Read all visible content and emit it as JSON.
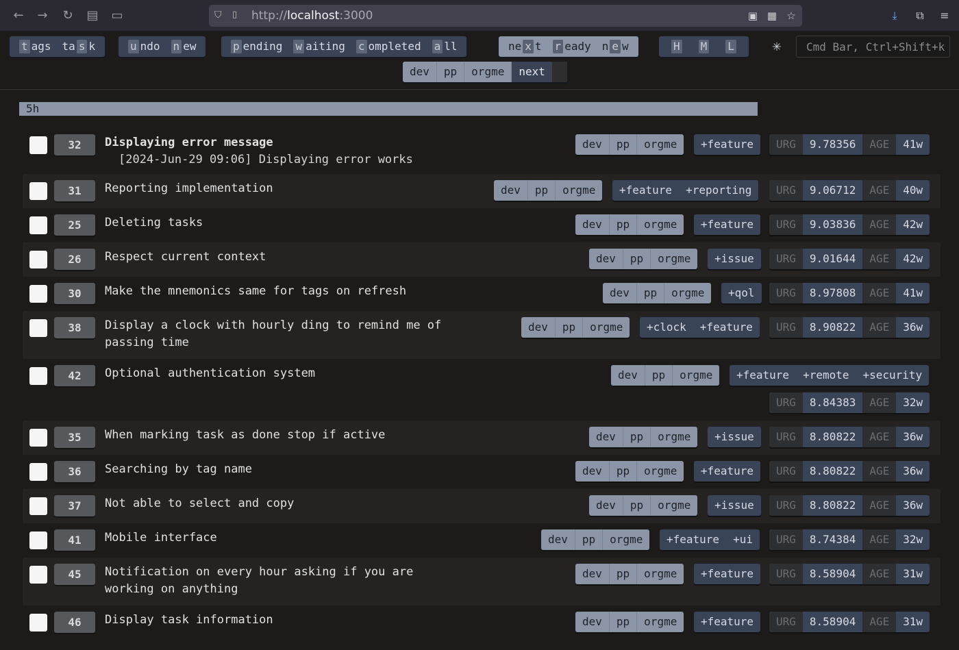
{
  "browser": {
    "url_proto": "http://",
    "url_host": "localhost",
    "url_port": ":3000"
  },
  "toolbar": {
    "groups": [
      {
        "buttons": [
          {
            "mnemonic": "t",
            "rest": "ags"
          },
          {
            "pre": "ta",
            "mnemonic": "s",
            "rest": "k"
          }
        ]
      },
      {
        "buttons": [
          {
            "mnemonic": "u",
            "rest": "ndo"
          },
          {
            "mnemonic": "n",
            "rest": "ew"
          }
        ]
      },
      {
        "buttons": [
          {
            "mnemonic": "p",
            "rest": "ending"
          },
          {
            "mnemonic": "w",
            "rest": "aiting"
          },
          {
            "mnemonic": "c",
            "rest": "ompleted"
          },
          {
            "mnemonic": "a",
            "rest": "ll"
          }
        ]
      },
      {
        "buttons": [
          {
            "pre": "ne",
            "mnemonic": "x",
            "rest": "t"
          },
          {
            "mnemonic": "r",
            "rest": "eady"
          },
          {
            "pre": "n",
            "mnemonic": "e",
            "rest": "w"
          }
        ]
      },
      {
        "buttons": [
          {
            "mnemonic": "H"
          },
          {
            "mnemonic": "M"
          },
          {
            "mnemonic": "L"
          }
        ]
      }
    ],
    "star": "✳",
    "cmd_placeholder": "Cmd Bar, Ctrl+Shift+k",
    "contexts": [
      "dev",
      "pp",
      "orgme",
      "next"
    ]
  },
  "group_header": "5h",
  "task_header": {
    "urg_label": "URG",
    "age_label": "AGE"
  },
  "tasks": [
    {
      "id": "32",
      "desc": "Displaying error message",
      "annotation": "[2024-Jun-29 09:06] Displaying error works",
      "bold": true,
      "project": [
        "dev",
        "pp",
        "orgme"
      ],
      "tags": [
        "+feature"
      ],
      "urg": "9.78356",
      "age": "41w"
    },
    {
      "id": "31",
      "desc": "Reporting implementation",
      "project": [
        "dev",
        "pp",
        "orgme"
      ],
      "tags": [
        "+feature",
        "+reporting"
      ],
      "urg": "9.06712",
      "age": "40w"
    },
    {
      "id": "25",
      "desc": "Deleting tasks",
      "project": [
        "dev",
        "pp",
        "orgme"
      ],
      "tags": [
        "+feature"
      ],
      "urg": "9.03836",
      "age": "42w"
    },
    {
      "id": "26",
      "desc": "Respect current context",
      "project": [
        "dev",
        "pp",
        "orgme"
      ],
      "tags": [
        "+issue"
      ],
      "urg": "9.01644",
      "age": "42w"
    },
    {
      "id": "30",
      "desc": "Make the mnemonics same for tags on refresh",
      "project": [
        "dev",
        "pp",
        "orgme"
      ],
      "tags": [
        "+qol"
      ],
      "urg": "8.97808",
      "age": "41w"
    },
    {
      "id": "38",
      "desc": "Display a clock with hourly ding to remind me of\npassing time",
      "project": [
        "dev",
        "pp",
        "orgme"
      ],
      "tags": [
        "+clock",
        "+feature"
      ],
      "urg": "8.90822",
      "age": "36w"
    },
    {
      "id": "42",
      "desc": "Optional authentication system",
      "project": [
        "dev",
        "pp",
        "orgme"
      ],
      "tags": [
        "+feature",
        "+remote",
        "+security"
      ],
      "urg": "8.84383",
      "age": "32w"
    },
    {
      "id": "35",
      "desc": "When marking task as done stop if active",
      "project": [
        "dev",
        "pp",
        "orgme"
      ],
      "tags": [
        "+issue"
      ],
      "urg": "8.80822",
      "age": "36w"
    },
    {
      "id": "36",
      "desc": "Searching by tag name",
      "project": [
        "dev",
        "pp",
        "orgme"
      ],
      "tags": [
        "+feature"
      ],
      "urg": "8.80822",
      "age": "36w"
    },
    {
      "id": "37",
      "desc": "Not able to select and copy",
      "project": [
        "dev",
        "pp",
        "orgme"
      ],
      "tags": [
        "+issue"
      ],
      "urg": "8.80822",
      "age": "36w"
    },
    {
      "id": "41",
      "desc": "Mobile interface",
      "project": [
        "dev",
        "pp",
        "orgme"
      ],
      "tags": [
        "+feature",
        "+ui"
      ],
      "urg": "8.74384",
      "age": "32w"
    },
    {
      "id": "45",
      "desc": "Notification on every hour asking if you are\nworking on anything",
      "project": [
        "dev",
        "pp",
        "orgme"
      ],
      "tags": [
        "+feature"
      ],
      "urg": "8.58904",
      "age": "31w"
    },
    {
      "id": "46",
      "desc": "Display task information",
      "project": [
        "dev",
        "pp",
        "orgme"
      ],
      "tags": [
        "+feature"
      ],
      "urg": "8.58904",
      "age": "31w"
    }
  ]
}
